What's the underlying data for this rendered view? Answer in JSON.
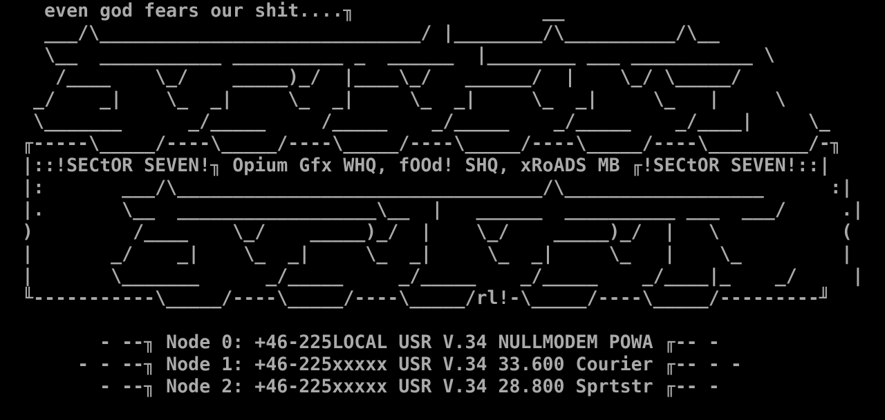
{
  "colors": {
    "background": "#000000",
    "foreground": "#aaaaaa"
  },
  "art": {
    "lines": [
      "    even god fears our shit....╖                 __",
      "    ___/\\_____________________________/ |________/\\__________/\\__",
      "    \\__  ___________ __________ _  ______  |________ ___ ___________ \\",
      "     /____    \\_/    _____)_/  |____\\_/   ______/  |    \\_/ \\_____/",
      "   _/    _|    \\_  _|     \\_  _|     \\_  _|     \\_  _|     \\_   |     \\",
      "   \\_______      _/_____     /_____    _/_____    _/_____    _/____|     \\_",
      "  ╓-----\\_____/----\\_____/----\\_____/----\\_____/----\\_____/----\\_________/-╖",
      "  |::!SECtOR SEVEN!╖ Opium Gfx WHQ, fOOd! SHQ, xRoADS MB ╓!SECtOR SEVEN!::|",
      "  |:       ___/\\_________________________________/\\__________________      :|",
      "  |.       \\__  __________________\\__  |   ______  __________ ___  ___/     .|",
      "  )         /____    \\_/    _____)_/  |    \\_/    _____)_/  |   \\           (",
      "  |       _/    _|    \\_  _|     \\_  _|     \\_  _|     \\_   |    \\_         |",
      "  |       \\_______      _/_____     _/_____    _/_____    _/____|_    _/     |",
      "  ╙-----------\\_____/----\\_____/----\\_____/rl!-\\_____/----\\_____/---------╜",
      "",
      "         - --╖ Node 0: +46-225LOCAL USR V.34 NULLMODEM POWA ╓-- -",
      "       - - --╖ Node 1: +46-225xxxxx USR V.34 33.600 Courier ╓-- - -",
      "         - --╖ Node 2: +46-225xxxxx USR V.34 28.800 Sprtstr ╓-- -"
    ]
  }
}
